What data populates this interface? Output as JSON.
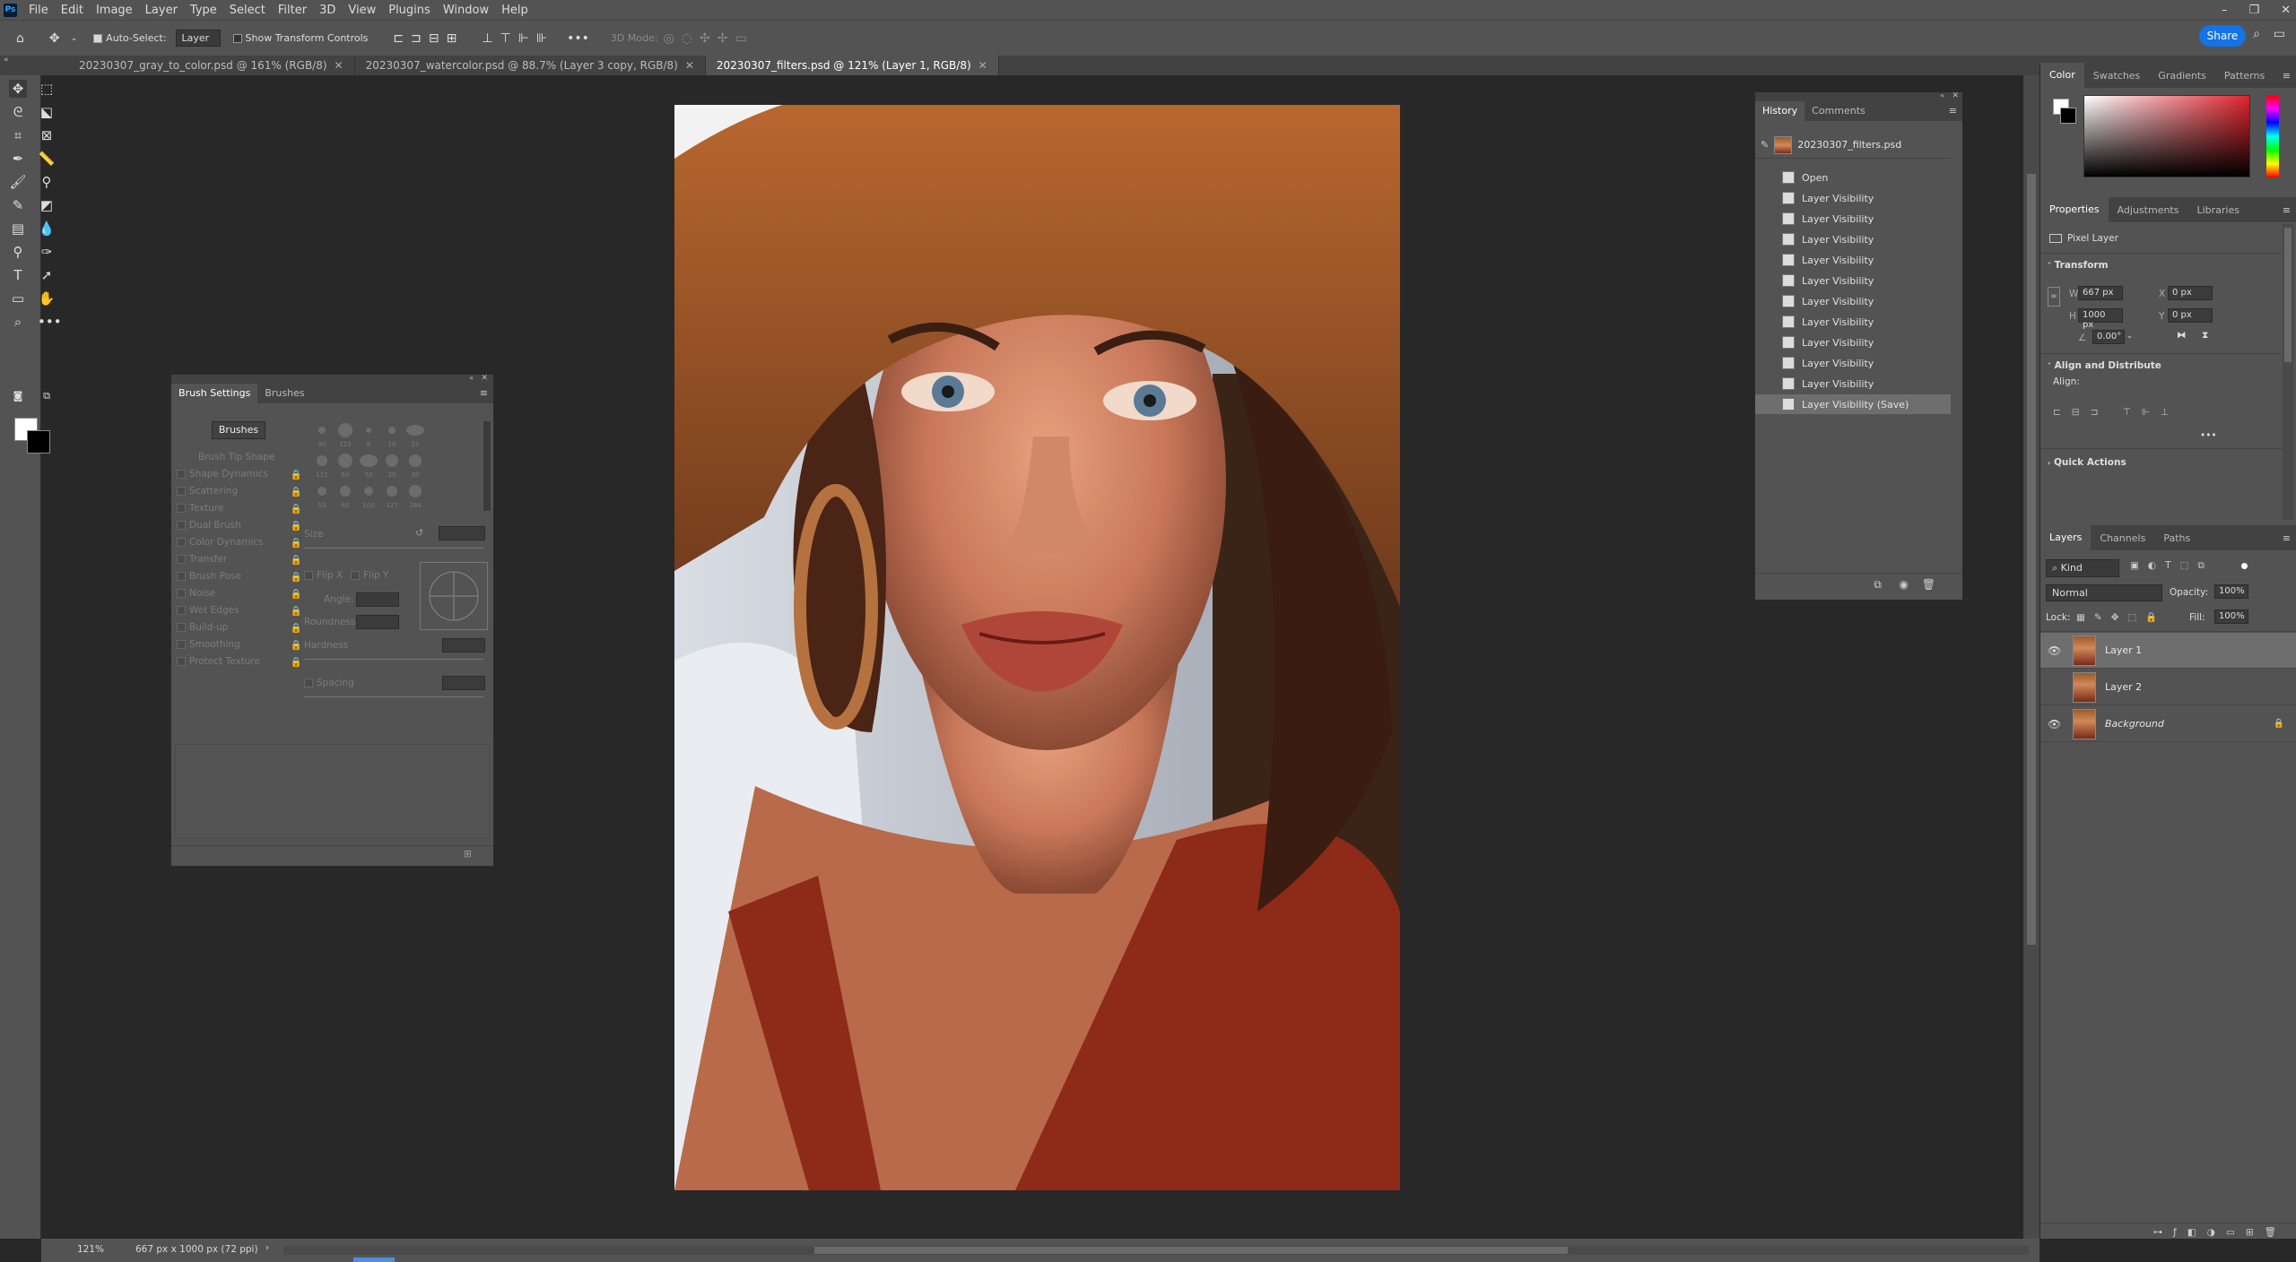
{
  "menu": [
    "File",
    "Edit",
    "Image",
    "Layer",
    "Type",
    "Select",
    "Filter",
    "3D",
    "View",
    "Plugins",
    "Window",
    "Help"
  ],
  "options": {
    "auto_select_label": "Auto-Select:",
    "auto_select_value": "Layer",
    "transform_label": "Show Transform Controls",
    "mode3d": "3D Mode:",
    "share": "Share"
  },
  "tabs": [
    {
      "label": "20230307_gray_to_color.psd @ 161% (RGB/8)"
    },
    {
      "label": "20230307_watercolor.psd @ 88.7% (Layer 3 copy, RGB/8)"
    },
    {
      "label": "20230307_filters.psd @ 121% (Layer 1, RGB/8)"
    }
  ],
  "brush_panel": {
    "tab_active": "Brush Settings",
    "tab_other": "Brushes",
    "brushes_button": "Brushes",
    "options": [
      "Brush Tip Shape",
      "Shape Dynamics",
      "Scattering",
      "Texture",
      "Dual Brush",
      "Color Dynamics",
      "Transfer",
      "Brush Pose",
      "Noise",
      "Wet Edges",
      "Build-up",
      "Smoothing",
      "Protect Texture"
    ],
    "size_label": "Size",
    "flip_x": "Flip X",
    "flip_y": "Flip Y",
    "angle": "Angle:",
    "roundness": "Roundness:",
    "hardness": "Hardness",
    "spacing": "Spacing",
    "preset_sizes": [
      "30",
      "123",
      "8",
      "10",
      "25",
      "112",
      "60",
      "50",
      "25",
      "30",
      "50",
      "60",
      "100",
      "127",
      "284"
    ]
  },
  "history": {
    "tab_active": "History",
    "tab_other": "Comments",
    "snapshot": "20230307_filters.psd",
    "items": [
      "Open",
      "Layer Visibility",
      "Layer Visibility",
      "Layer Visibility",
      "Layer Visibility",
      "Layer Visibility",
      "Layer Visibility",
      "Layer Visibility",
      "Layer Visibility",
      "Layer Visibility",
      "Layer Visibility",
      "Layer Visibility (Save)"
    ]
  },
  "color_panel": {
    "tabs": [
      "Color",
      "Swatches",
      "Gradients",
      "Patterns"
    ]
  },
  "properties": {
    "tabs": [
      "Properties",
      "Adjustments",
      "Libraries"
    ],
    "kind": "Pixel Layer",
    "transform": "Transform",
    "w_label": "W",
    "w": "667 px",
    "h_label": "H",
    "h": "1000 px",
    "x_label": "X",
    "x": "0 px",
    "y_label": "Y",
    "y": "0 px",
    "angle": "0.00°",
    "align_section": "Align and Distribute",
    "align_label": "Align:",
    "quick_actions": "Quick Actions"
  },
  "layers": {
    "tabs": [
      "Layers",
      "Channels",
      "Paths"
    ],
    "kind": "Kind",
    "blend": "Normal",
    "opacity_label": "Opacity:",
    "opacity": "100%",
    "lock_label": "Lock:",
    "fill_label": "Fill:",
    "fill": "100%",
    "items": [
      {
        "name": "Layer 1",
        "visible": true,
        "selected": true
      },
      {
        "name": "Layer 2",
        "visible": false,
        "selected": false
      },
      {
        "name": "Background",
        "visible": true,
        "selected": false
      }
    ]
  },
  "status": {
    "zoom": "121%",
    "doc": "667 px x 1000 px (72 ppi)"
  },
  "colors": {
    "accent": "#1473e6",
    "panel": "#535353",
    "canvas_bg": "#282828"
  }
}
